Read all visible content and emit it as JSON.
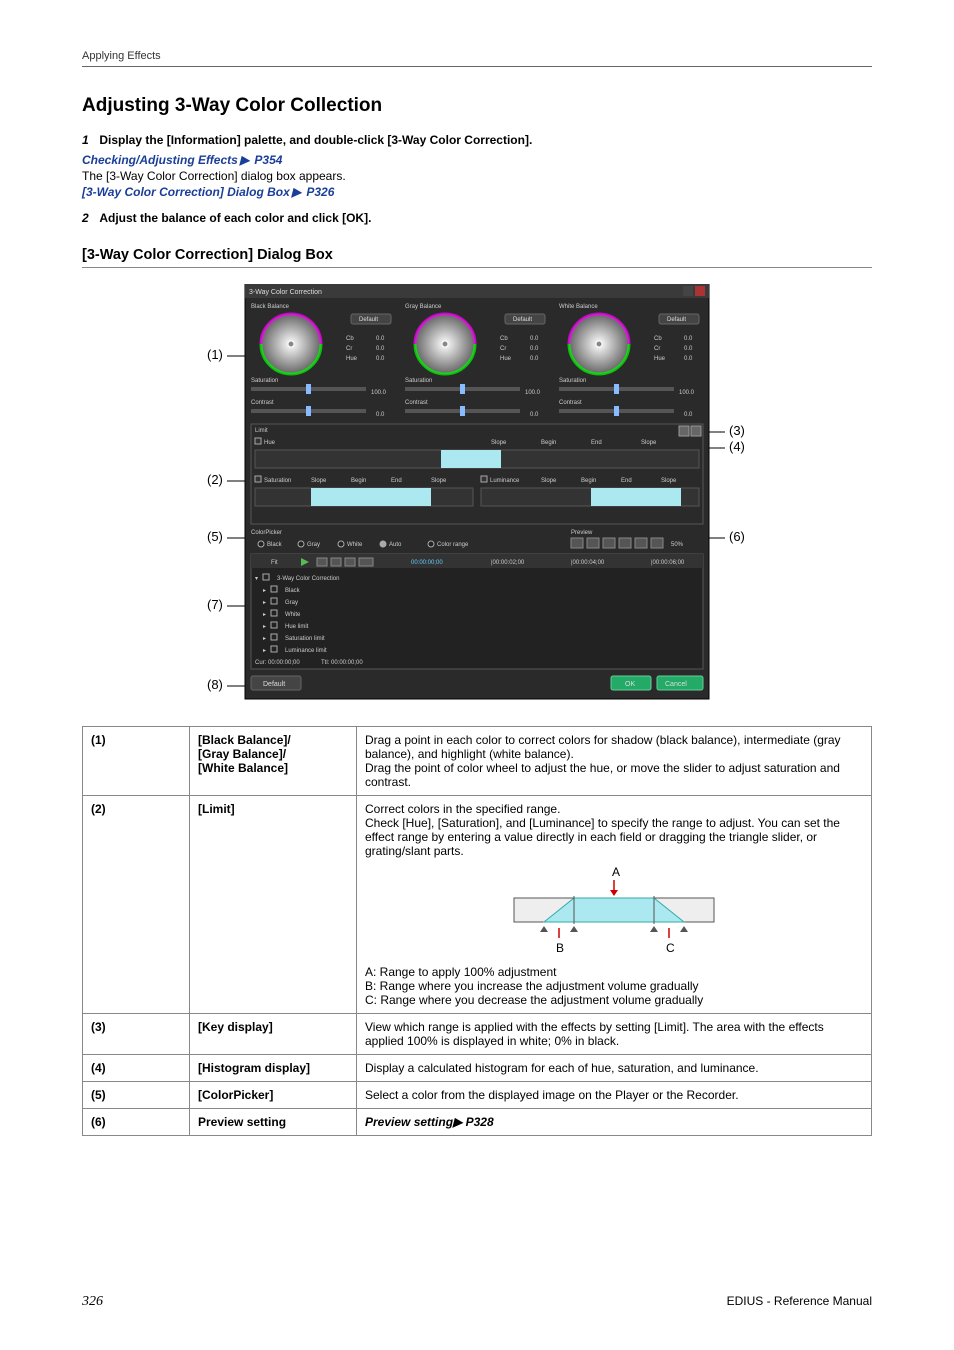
{
  "header": {
    "section": "Applying Effects"
  },
  "title": "Adjusting 3-Way Color Collection",
  "steps": [
    {
      "num": "1",
      "text": "Display the [Information] palette, and double-click [3-Way Color Correction]."
    },
    {
      "num": "2",
      "text": "Adjust the balance of each color and click [OK]."
    }
  ],
  "links": {
    "checking": {
      "label": "Checking/Adjusting Effects",
      "page": "P354"
    },
    "dialog": {
      "label": "[3-Way Color Correction] Dialog Box",
      "page": "P326"
    }
  },
  "plain_lines": {
    "appears": "The [3-Way Color Correction] dialog box appears."
  },
  "subheading": "[3-Way Color Correction] Dialog Box",
  "callouts": {
    "c1": "(1)",
    "c2": "(2)",
    "c3": "(3)",
    "c4": "(4)",
    "c5": "(5)",
    "c6": "(6)",
    "c7": "(7)",
    "c8": "(8)"
  },
  "dialog": {
    "title": "3-Way Color Correction",
    "panels": {
      "black": {
        "name": "Black Balance",
        "default": "Default",
        "labels": [
          "Cb",
          "Cr",
          "Hue"
        ],
        "vals": [
          "0.0",
          "0.0",
          "0.0"
        ],
        "sat": "Saturation",
        "satv": "100.0",
        "con": "Contrast",
        "conv": "0.0"
      },
      "gray": {
        "name": "Gray Balance",
        "default": "Default",
        "labels": [
          "Cb",
          "Cr",
          "Hue"
        ],
        "vals": [
          "0.0",
          "0.0",
          "0.0"
        ],
        "sat": "Saturation",
        "satv": "100.0",
        "con": "Contrast",
        "conv": "0.0"
      },
      "white": {
        "name": "White Balance",
        "default": "Default",
        "labels": [
          "Cb",
          "Cr",
          "Hue"
        ],
        "vals": [
          "0.0",
          "0.0",
          "0.0"
        ],
        "sat": "Saturation",
        "satv": "100.0",
        "con": "Contrast",
        "conv": "0.0"
      }
    },
    "limit": {
      "title": "Limit",
      "hue": "Hue",
      "saturation": "Saturation",
      "luminance": "Luminance",
      "fields": [
        "Slope",
        "Begin",
        "End",
        "Slope"
      ]
    },
    "colorpicker": {
      "title": "ColorPicker",
      "black": "Black",
      "gray": "Gray",
      "white": "White",
      "auto": "Auto",
      "range": "Color range"
    },
    "preview": {
      "title": "Preview",
      "pct": "50%"
    },
    "timeline": {
      "fit": "Fit",
      "marks": [
        "00:00:00;00",
        "|00:00:02;00",
        "|00:00:04;00",
        "|00:00:06;00"
      ],
      "items": [
        "3-Way Color Correction",
        "Black",
        "Gray",
        "White",
        "Hue limit",
        "Saturation limit",
        "Luminance limit"
      ],
      "cur": "Cur: 00:00:00;00",
      "ttl": "Ttl: 00:00:00;00"
    },
    "buttons": {
      "default": "Default",
      "ok": "OK",
      "cancel": "Cancel"
    }
  },
  "table": {
    "rows": [
      {
        "id": "(1)",
        "name": "[Black Balance]/\n[Gray Balance]/\n[White Balance]",
        "desc": "Drag a point in each color to correct colors for shadow (black balance), intermediate (gray balance), and highlight (white balance).\nDrag the point of color wheel to adjust the hue, or move the slider to adjust saturation and contrast."
      },
      {
        "id": "(2)",
        "name": "[Limit]",
        "desc": "Correct colors in the specified range.\nCheck [Hue], [Saturation], and [Luminance] to specify the range to adjust. You can set the effect range by entering a value directly in each field or dragging the triangle slider, or grating/slant parts.",
        "after": {
          "A": "A",
          "B": "B",
          "C": "C",
          "lA": "A: Range to apply 100% adjustment",
          "lB": "B: Range where you increase the adjustment volume gradually",
          "lC": "C: Range where you decrease the adjustment volume gradually"
        }
      },
      {
        "id": "(3)",
        "name": "[Key display]",
        "desc": "View which range is applied with the effects by setting [Limit]. The area with the effects applied 100% is displayed in white; 0% in black."
      },
      {
        "id": "(4)",
        "name": "[Histogram display]",
        "desc": "Display a calculated histogram for each of hue, saturation, and luminance."
      },
      {
        "id": "(5)",
        "name": "[ColorPicker]",
        "desc": "Select a color from the displayed image on the Player or the Recorder."
      },
      {
        "id": "(6)",
        "name": "Preview setting",
        "desc_link": {
          "label": "Preview setting",
          "page": "P328"
        }
      }
    ]
  },
  "footer": {
    "page": "326",
    "doc": "EDIUS - Reference Manual"
  }
}
